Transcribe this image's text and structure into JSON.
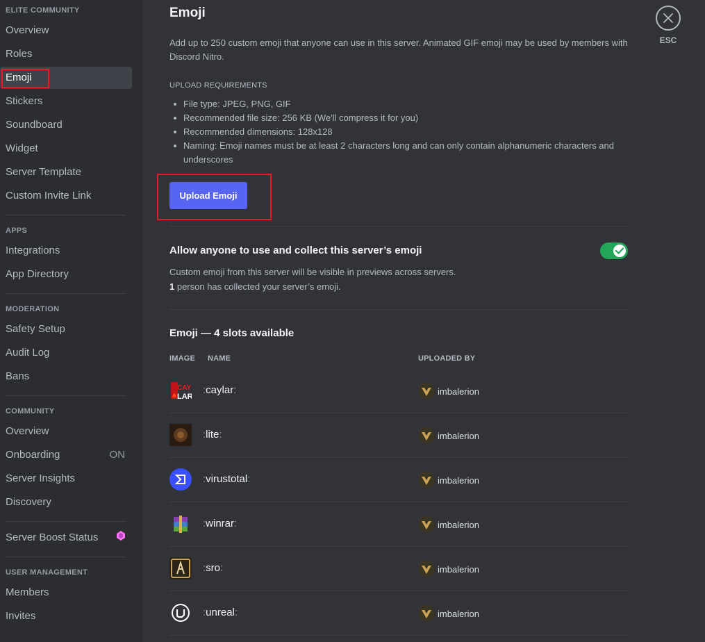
{
  "sidebar": {
    "section_elite": "ELITE COMMUNITY",
    "overview": "Overview",
    "roles": "Roles",
    "emoji": "Emoji",
    "stickers": "Stickers",
    "soundboard": "Soundboard",
    "widget": "Widget",
    "server_template": "Server Template",
    "custom_invite": "Custom Invite Link",
    "section_apps": "APPS",
    "integrations": "Integrations",
    "app_directory": "App Directory",
    "section_moderation": "MODERATION",
    "safety_setup": "Safety Setup",
    "audit_log": "Audit Log",
    "bans": "Bans",
    "section_community": "COMMUNITY",
    "community_overview": "Overview",
    "onboarding": "Onboarding",
    "onboarding_status": "ON",
    "server_insights": "Server Insights",
    "discovery": "Discovery",
    "server_boost": "Server Boost Status",
    "section_user_mgmt": "USER MANAGEMENT",
    "members": "Members",
    "invites": "Invites"
  },
  "main": {
    "title": "Emoji",
    "description": "Add up to 250 custom emoji that anyone can use in this server. Animated GIF emoji may be used by members with Discord Nitro.",
    "requirements_header": "UPLOAD REQUIREMENTS",
    "requirements": [
      "File type: JPEG, PNG, GIF",
      "Recommended file size: 256 KB (We'll compress it for you)",
      "Recommended dimensions: 128x128",
      "Naming: Emoji names must be at least 2 characters long and can only contain alphanumeric characters and underscores"
    ],
    "upload_button": "Upload Emoji",
    "allow_title": "Allow anyone to use and collect this server’s emoji",
    "allow_desc": "Custom emoji from this server will be visible in previews across servers.",
    "collected_count": "1",
    "collected_text": " person has collected your server’s emoji.",
    "list_title": "Emoji — 4 slots available",
    "col_image": "IMAGE",
    "col_name": "NAME",
    "col_uploaded_by": "UPLOADED BY"
  },
  "emojis": [
    {
      "name": "caylar",
      "uploader": "imbalerion",
      "icon": "caylar-emoji"
    },
    {
      "name": "lite",
      "uploader": "imbalerion",
      "icon": "lite-emoji"
    },
    {
      "name": "virustotal",
      "uploader": "imbalerion",
      "icon": "virustotal-emoji"
    },
    {
      "name": "winrar",
      "uploader": "imbalerion",
      "icon": "winrar-emoji"
    },
    {
      "name": "sro",
      "uploader": "imbalerion",
      "icon": "sro-emoji"
    },
    {
      "name": "unreal",
      "uploader": "imbalerion",
      "icon": "unreal-emoji"
    }
  ],
  "close": {
    "label": "ESC"
  },
  "colors": {
    "accent": "#5865f2",
    "toggle_on": "#23a55a",
    "highlight_box": "#e01e24"
  }
}
